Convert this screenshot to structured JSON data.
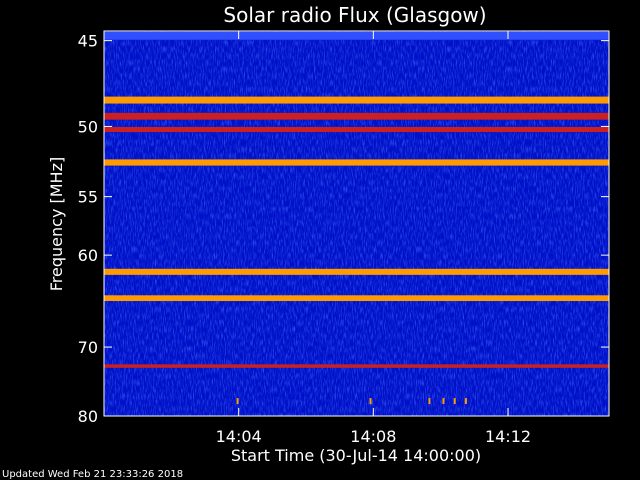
{
  "chart_data": {
    "type": "heatmap",
    "title": "Solar radio Flux (Glasgow)",
    "xlabel": "Start Time (30-Jul-14 14:00:00)",
    "ylabel": "Frequency [MHz]",
    "xlim": [
      "14:00:00",
      "14:15:00"
    ],
    "ylim": [
      80,
      44.5
    ],
    "y_ticks": [
      45,
      50,
      55,
      60,
      70,
      80
    ],
    "x_ticks": [
      "14:04",
      "14:08",
      "14:12"
    ],
    "colors": {
      "background": "#0010c8",
      "weak_band": "#3050ff",
      "moderate_band": "#cc2020",
      "strong_band": "#ff9a00",
      "peak_band": "#e8ff40"
    },
    "bands": [
      {
        "freq_start": 44.6,
        "freq_end": 44.9,
        "intensity": "weak"
      },
      {
        "freq_start": 48.2,
        "freq_end": 48.5,
        "intensity": "strong"
      },
      {
        "freq_start": 49.2,
        "freq_end": 49.5,
        "intensity": "moderate"
      },
      {
        "freq_start": 50.1,
        "freq_end": 50.3,
        "intensity": "moderate"
      },
      {
        "freq_start": 52.3,
        "freq_end": 52.6,
        "intensity": "strong"
      },
      {
        "freq_start": 61.4,
        "freq_end": 61.8,
        "intensity": "strong"
      },
      {
        "freq_start": 64.1,
        "freq_end": 64.5,
        "intensity": "strong"
      },
      {
        "freq_start": 72.4,
        "freq_end": 72.6,
        "intensity": "moderate"
      }
    ],
    "bursts": [
      {
        "time": "14:03:58",
        "freq": 77.6
      },
      {
        "time": "14:07:55",
        "freq": 77.6
      },
      {
        "time": "14:09:40",
        "freq": 77.6
      },
      {
        "time": "14:10:05",
        "freq": 77.6
      },
      {
        "time": "14:10:25",
        "freq": 77.6
      },
      {
        "time": "14:10:45",
        "freq": 77.6
      }
    ]
  },
  "footer_text": "Updated Wed Feb 21 23:33:26 2018"
}
